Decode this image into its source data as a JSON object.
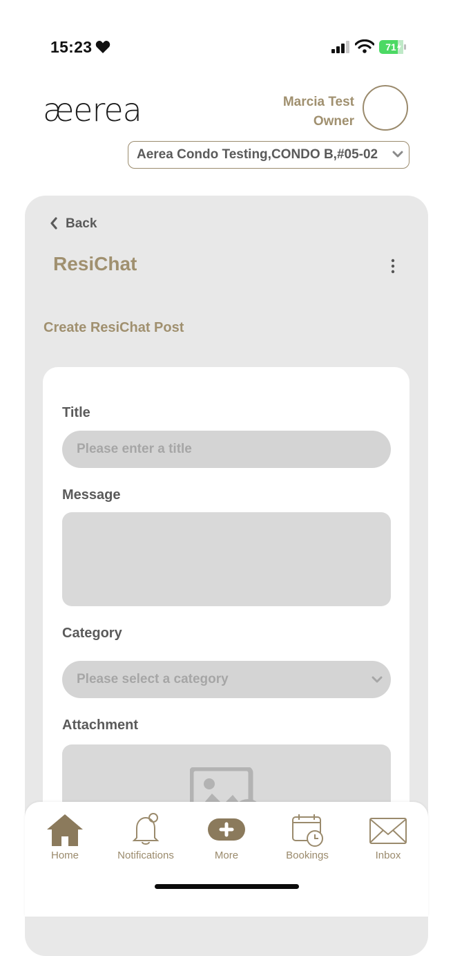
{
  "status_bar": {
    "time": "15:23",
    "battery": "71"
  },
  "header": {
    "logo": "æerea",
    "user_name": "Marcia Test",
    "user_role": "Owner",
    "unit": "Aerea Condo Testing,CONDO B,#05-02"
  },
  "page": {
    "back_label": "Back",
    "title": "ResiChat",
    "section_heading": "Create ResiChat Post"
  },
  "form": {
    "title_label": "Title",
    "title_placeholder": "Please enter a title",
    "message_label": "Message",
    "category_label": "Category",
    "category_placeholder": "Please select a category",
    "attachment_label": "Attachment"
  },
  "nav": {
    "items": [
      {
        "label": "Home",
        "icon": "home-icon"
      },
      {
        "label": "Notifications",
        "icon": "bell-icon"
      },
      {
        "label": "More",
        "icon": "plus-pill-icon"
      },
      {
        "label": "Bookings",
        "icon": "calendar-clock-icon"
      },
      {
        "label": "Inbox",
        "icon": "envelope-icon"
      }
    ]
  },
  "colors": {
    "accent": "#a0906f",
    "panel": "#e8e8e8",
    "field": "#d4d4d4",
    "battery": "#4cd964"
  }
}
